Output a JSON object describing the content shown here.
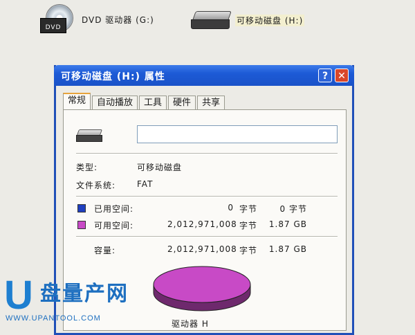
{
  "desktop": {
    "dvd_drive_label": "DVD 驱动器 (G:)",
    "dvd_box_text": "DVD",
    "removable_drive_label": "可移动磁盘 (H:)"
  },
  "dialog": {
    "title": "可移动磁盘 (H:) 属性",
    "help_label": "?",
    "close_label": "✕",
    "tabs": [
      {
        "label": "常规",
        "active": true
      },
      {
        "label": "自动播放",
        "active": false
      },
      {
        "label": "工具",
        "active": false
      },
      {
        "label": "硬件",
        "active": false
      },
      {
        "label": "共享",
        "active": false
      }
    ],
    "name_value": "",
    "type_label": "类型:",
    "type_value": "可移动磁盘",
    "fs_label": "文件系统:",
    "fs_value": "FAT",
    "used": {
      "label": "已用空间:",
      "bytes": "0",
      "unit": "字节",
      "size": "0 字节",
      "color": "#1f3fbf"
    },
    "free": {
      "label": "可用空间:",
      "bytes": "2,012,971,008",
      "unit": "字节",
      "size": "1.87 GB",
      "color": "#c84ac6"
    },
    "capacity": {
      "label": "容量:",
      "bytes": "2,012,971,008",
      "unit": "字节",
      "size": "1.87 GB"
    },
    "drive_caption": "驱动器 H"
  },
  "chart_data": {
    "type": "pie",
    "categories": [
      "已用空间",
      "可用空间"
    ],
    "values": [
      0,
      2012971008
    ],
    "colors": [
      "#1f3fbf",
      "#c84ac6"
    ]
  },
  "watermark": {
    "letter": "U",
    "brand": "盘量产网",
    "url": "WWW.UPANTOOL.COM"
  }
}
